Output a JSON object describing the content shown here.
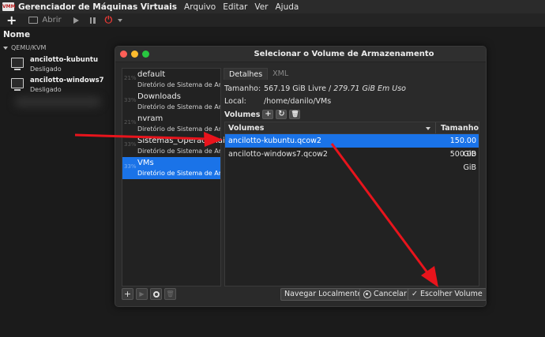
{
  "app": {
    "logo": "VMM",
    "title": "Gerenciador de Máquinas Virtuais",
    "menu": [
      "Arquivo",
      "Editar",
      "Ver",
      "Ajuda"
    ]
  },
  "toolbar": {
    "open_label": "Abrir"
  },
  "list": {
    "column_header": "Nome",
    "group": "QEMU/KVM",
    "vms": [
      {
        "name": "ancilotto-kubuntu",
        "state": "Desligado"
      },
      {
        "name": "ancilotto-windows7",
        "state": "Desligado"
      }
    ]
  },
  "dialog": {
    "title": "Selecionar o Volume de Armazenamento",
    "pools": [
      {
        "name": "default",
        "desc": "Diretório de Sistema de Ar...",
        "pct": "21%"
      },
      {
        "name": "Downloads",
        "desc": "Diretório de Sistema de Ar...",
        "pct": "33%"
      },
      {
        "name": "nvram",
        "desc": "Diretório de Sistema de Ar...",
        "pct": "21%"
      },
      {
        "name": "Sistemas_Operacionais",
        "desc": "Diretório de Sistema de Ar...",
        "pct": "33%"
      },
      {
        "name": "VMs",
        "desc": "Diretório de Sistema de Ar...",
        "pct": "33%"
      }
    ],
    "selected_pool": 4,
    "tabs": [
      "Detalhes",
      "XML"
    ],
    "size_label": "Tamanho:",
    "size_free": "567.19 GiB Livre",
    "size_used": "279.71 GiB Em Uso",
    "location_label": "Local:",
    "location_value": "/home/danilo/VMs",
    "volumes_label": "Volumes",
    "table": {
      "col_volumes": "Volumes",
      "col_size": "Tamanho",
      "rows": [
        {
          "name": "ancilotto-kubuntu.qcow2",
          "size": "150.00 GiB"
        },
        {
          "name": "ancilotto-windows7.qcow2",
          "size": "500.00 GiB"
        }
      ],
      "selected_row": 0
    },
    "buttons": {
      "browse_local": "Navegar Localmente",
      "cancel": "Cancelar",
      "choose": "Escolher Volume"
    }
  },
  "colors": {
    "selection": "#1a73e8",
    "annotation_arrow": "#e8141c",
    "power": "#e53935"
  }
}
